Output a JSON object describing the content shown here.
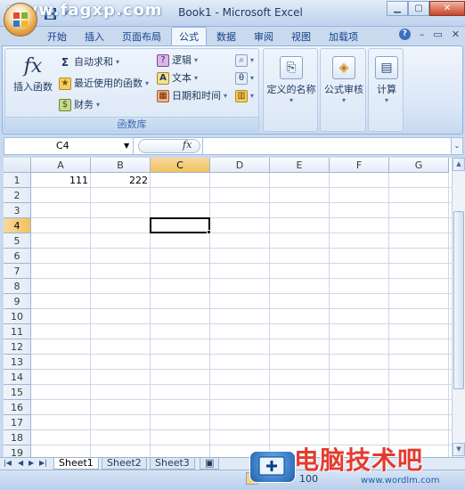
{
  "window": {
    "title": "Book1 - Microsoft Excel"
  },
  "qat": {
    "items": [
      "save-icon",
      "undo-icon",
      "redo-icon",
      "customize-icon"
    ]
  },
  "tabs": [
    "开始",
    "插入",
    "页面布局",
    "公式",
    "数据",
    "审阅",
    "视图",
    "加载项"
  ],
  "active_tab": "公式",
  "ribbon": {
    "function_library": {
      "label": "函数库",
      "insert_function": "插入函数",
      "fx_glyph": "fx",
      "autosum": "自动求和",
      "recent": "最近使用的函数",
      "financial": "财务",
      "logical": "逻辑",
      "text": "文本",
      "datetime": "日期和时间"
    },
    "defined_names": "定义的名称",
    "formula_auditing": "公式审核",
    "calculation": "计算"
  },
  "formula_bar": {
    "name_box": "C4",
    "fx": "fx",
    "formula": ""
  },
  "columns": [
    "A",
    "B",
    "C",
    "D",
    "E",
    "F",
    "G"
  ],
  "rows": [
    "1",
    "2",
    "3",
    "4",
    "5",
    "6",
    "7",
    "8",
    "9",
    "10",
    "11",
    "12",
    "13",
    "14",
    "15",
    "16",
    "17",
    "18",
    "19"
  ],
  "cells": {
    "A1": "111",
    "B1": "222"
  },
  "selected_cell": "C4",
  "sheets": [
    "Sheet1",
    "Sheet2",
    "Sheet3"
  ],
  "active_sheet": "Sheet1",
  "status": {
    "zoom": "100"
  },
  "watermarks": {
    "left": "www.fagxp.com",
    "right": "电脑技术吧",
    "url": "www.wordlm.com"
  }
}
